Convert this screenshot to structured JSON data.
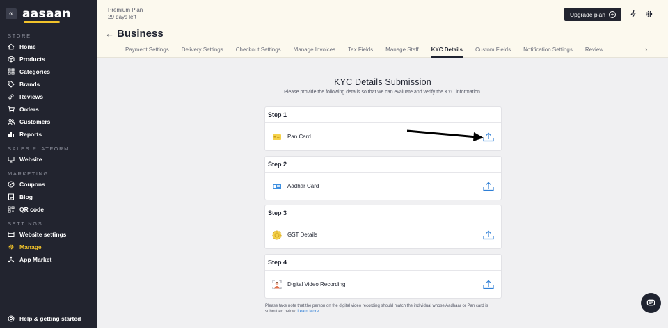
{
  "sidebar": {
    "logo": "aasaan",
    "collapse_icon": "«",
    "sections": [
      {
        "label": "STORE",
        "items": [
          {
            "label": "Home",
            "icon": "home-icon"
          },
          {
            "label": "Products",
            "icon": "products-icon"
          },
          {
            "label": "Categories",
            "icon": "categories-icon"
          },
          {
            "label": "Brands",
            "icon": "tag-icon"
          },
          {
            "label": "Reviews",
            "icon": "link-icon"
          },
          {
            "label": "Orders",
            "icon": "cart-icon"
          },
          {
            "label": "Customers",
            "icon": "users-icon"
          },
          {
            "label": "Reports",
            "icon": "chart-icon"
          }
        ]
      },
      {
        "label": "SALES PLATFORM",
        "items": [
          {
            "label": "Website",
            "icon": "monitor-icon"
          }
        ]
      },
      {
        "label": "MARKETING",
        "items": [
          {
            "label": "Coupons",
            "icon": "coupon-icon"
          },
          {
            "label": "Blog",
            "icon": "blog-icon"
          },
          {
            "label": "QR code",
            "icon": "qr-icon"
          }
        ]
      },
      {
        "label": "SETTINGS",
        "items": [
          {
            "label": "Website settings",
            "icon": "website-settings-icon"
          },
          {
            "label": "Manage",
            "icon": "gear-icon",
            "active": true
          },
          {
            "label": "App Market",
            "icon": "app-market-icon"
          }
        ]
      }
    ],
    "help_label": "Help & getting started"
  },
  "header": {
    "plan_name": "Premium Plan",
    "plan_days": "29 days left",
    "title": "Business",
    "upgrade_label": "Upgrade plan",
    "tabs": [
      "Payment Settings",
      "Delivery Settings",
      "Checkout Settings",
      "Manage Invoices",
      "Tax Fields",
      "Manage Staff",
      "KYC Details",
      "Custom Fields",
      "Notification Settings",
      "Review"
    ],
    "active_tab": "KYC Details"
  },
  "main": {
    "title": "KYC Details Submission",
    "subtitle": "Please provide the following details so that we can evaluate and verify the KYC information.",
    "steps": [
      {
        "step": "Step 1",
        "label": "Pan Card",
        "icon": "pan-card-icon"
      },
      {
        "step": "Step 2",
        "label": "Aadhar Card",
        "icon": "aadhar-card-icon"
      },
      {
        "step": "Step 3",
        "label": "GST Details",
        "icon": "gst-icon"
      },
      {
        "step": "Step 4",
        "label": "Digital Video Recording",
        "icon": "video-recording-icon"
      }
    ],
    "note": "Please take note that the person on the digital video recording should match the individual whose Aadhaar or Pan card is submitted below.",
    "note_link": "Learn More"
  },
  "colors": {
    "sidebar_bg": "#22242f",
    "accent": "#f2c32b",
    "header_bg": "#fcf9ee",
    "main_bg": "#f0f0f2",
    "upload_blue": "#2f7fd6"
  }
}
